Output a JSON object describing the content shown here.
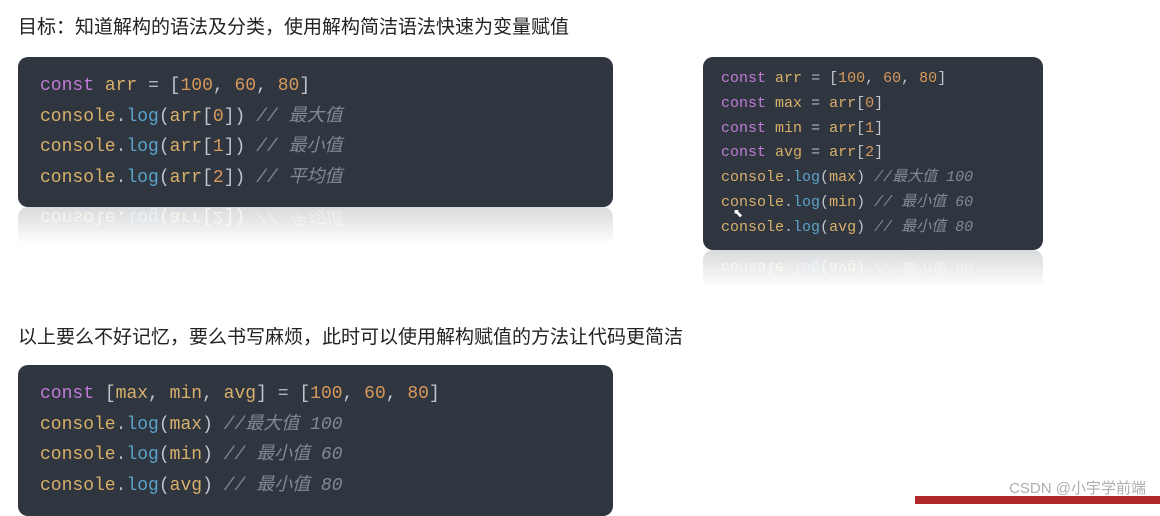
{
  "heading": "目标：知道解构的语法及分类，使用解构简洁语法快速为变量赋值",
  "code1": {
    "lines": [
      {
        "tokens": [
          {
            "c": "kw",
            "t": "const"
          },
          {
            "c": "",
            "t": " "
          },
          {
            "c": "var",
            "t": "arr"
          },
          {
            "c": "",
            "t": " "
          },
          {
            "c": "op",
            "t": "="
          },
          {
            "c": "",
            "t": " "
          },
          {
            "c": "paren",
            "t": "["
          },
          {
            "c": "num",
            "t": "100"
          },
          {
            "c": "paren",
            "t": ", "
          },
          {
            "c": "num",
            "t": "60"
          },
          {
            "c": "paren",
            "t": ", "
          },
          {
            "c": "num",
            "t": "80"
          },
          {
            "c": "paren",
            "t": "]"
          }
        ]
      },
      {
        "tokens": [
          {
            "c": "var",
            "t": "console"
          },
          {
            "c": "op",
            "t": "."
          },
          {
            "c": "fn",
            "t": "log"
          },
          {
            "c": "paren",
            "t": "("
          },
          {
            "c": "var",
            "t": "arr"
          },
          {
            "c": "paren",
            "t": "["
          },
          {
            "c": "num",
            "t": "0"
          },
          {
            "c": "paren",
            "t": "])"
          },
          {
            "c": "",
            "t": " "
          },
          {
            "c": "comment",
            "t": "// 最大值"
          }
        ]
      },
      {
        "tokens": [
          {
            "c": "var",
            "t": "console"
          },
          {
            "c": "op",
            "t": "."
          },
          {
            "c": "fn",
            "t": "log"
          },
          {
            "c": "paren",
            "t": "("
          },
          {
            "c": "var",
            "t": "arr"
          },
          {
            "c": "paren",
            "t": "["
          },
          {
            "c": "num",
            "t": "1"
          },
          {
            "c": "paren",
            "t": "])"
          },
          {
            "c": "",
            "t": " "
          },
          {
            "c": "comment",
            "t": "// 最小值"
          }
        ]
      },
      {
        "tokens": [
          {
            "c": "var",
            "t": "console"
          },
          {
            "c": "op",
            "t": "."
          },
          {
            "c": "fn",
            "t": "log"
          },
          {
            "c": "paren",
            "t": "("
          },
          {
            "c": "var",
            "t": "arr"
          },
          {
            "c": "paren",
            "t": "["
          },
          {
            "c": "num",
            "t": "2"
          },
          {
            "c": "paren",
            "t": "])"
          },
          {
            "c": "",
            "t": " "
          },
          {
            "c": "comment",
            "t": "// 平均值"
          }
        ]
      }
    ]
  },
  "code2": {
    "lines": [
      {
        "tokens": [
          {
            "c": "kw",
            "t": "const"
          },
          {
            "c": "",
            "t": " "
          },
          {
            "c": "var",
            "t": "arr"
          },
          {
            "c": "",
            "t": " "
          },
          {
            "c": "op",
            "t": "="
          },
          {
            "c": "",
            "t": " "
          },
          {
            "c": "paren",
            "t": "["
          },
          {
            "c": "num",
            "t": "100"
          },
          {
            "c": "paren",
            "t": ", "
          },
          {
            "c": "num",
            "t": "60"
          },
          {
            "c": "paren",
            "t": ", "
          },
          {
            "c": "num",
            "t": "80"
          },
          {
            "c": "paren",
            "t": "]"
          }
        ]
      },
      {
        "tokens": [
          {
            "c": "kw",
            "t": "const"
          },
          {
            "c": "",
            "t": " "
          },
          {
            "c": "var",
            "t": "max"
          },
          {
            "c": "",
            "t": " "
          },
          {
            "c": "op",
            "t": "="
          },
          {
            "c": "",
            "t": " "
          },
          {
            "c": "var",
            "t": "arr"
          },
          {
            "c": "paren",
            "t": "["
          },
          {
            "c": "num",
            "t": "0"
          },
          {
            "c": "paren",
            "t": "]"
          }
        ]
      },
      {
        "tokens": [
          {
            "c": "kw",
            "t": "const"
          },
          {
            "c": "",
            "t": " "
          },
          {
            "c": "var",
            "t": "min"
          },
          {
            "c": "",
            "t": " "
          },
          {
            "c": "op",
            "t": "="
          },
          {
            "c": "",
            "t": " "
          },
          {
            "c": "var",
            "t": "arr"
          },
          {
            "c": "paren",
            "t": "["
          },
          {
            "c": "num",
            "t": "1"
          },
          {
            "c": "paren",
            "t": "]"
          }
        ]
      },
      {
        "tokens": [
          {
            "c": "kw",
            "t": "const"
          },
          {
            "c": "",
            "t": " "
          },
          {
            "c": "var",
            "t": "avg"
          },
          {
            "c": "",
            "t": " "
          },
          {
            "c": "op",
            "t": "="
          },
          {
            "c": "",
            "t": " "
          },
          {
            "c": "var",
            "t": "arr"
          },
          {
            "c": "paren",
            "t": "["
          },
          {
            "c": "num",
            "t": "2"
          },
          {
            "c": "paren",
            "t": "]"
          }
        ]
      },
      {
        "tokens": [
          {
            "c": "var",
            "t": "console"
          },
          {
            "c": "op",
            "t": "."
          },
          {
            "c": "fn",
            "t": "log"
          },
          {
            "c": "paren",
            "t": "("
          },
          {
            "c": "var",
            "t": "max"
          },
          {
            "c": "paren",
            "t": ")"
          },
          {
            "c": "",
            "t": " "
          },
          {
            "c": "comment",
            "t": "//最大值 100"
          }
        ]
      },
      {
        "tokens": [
          {
            "c": "var",
            "t": "console"
          },
          {
            "c": "op",
            "t": "."
          },
          {
            "c": "fn",
            "t": "log"
          },
          {
            "c": "paren",
            "t": "("
          },
          {
            "c": "var",
            "t": "min"
          },
          {
            "c": "paren",
            "t": ")"
          },
          {
            "c": "",
            "t": " "
          },
          {
            "c": "comment",
            "t": "// 最小值 60"
          }
        ]
      },
      {
        "tokens": [
          {
            "c": "var",
            "t": "console"
          },
          {
            "c": "op",
            "t": "."
          },
          {
            "c": "fn",
            "t": "log"
          },
          {
            "c": "paren",
            "t": "("
          },
          {
            "c": "var",
            "t": "avg"
          },
          {
            "c": "paren",
            "t": ")"
          },
          {
            "c": "",
            "t": " "
          },
          {
            "c": "comment",
            "t": "// 最小值 80"
          }
        ]
      }
    ]
  },
  "paragraph": "以上要么不好记忆，要么书写麻烦，此时可以使用解构赋值的方法让代码更简洁",
  "code3": {
    "lines": [
      {
        "tokens": [
          {
            "c": "kw",
            "t": "const"
          },
          {
            "c": "",
            "t": " "
          },
          {
            "c": "paren",
            "t": "["
          },
          {
            "c": "var",
            "t": "max"
          },
          {
            "c": "paren",
            "t": ", "
          },
          {
            "c": "var",
            "t": "min"
          },
          {
            "c": "paren",
            "t": ", "
          },
          {
            "c": "var",
            "t": "avg"
          },
          {
            "c": "paren",
            "t": "]"
          },
          {
            "c": "",
            "t": " "
          },
          {
            "c": "op",
            "t": "="
          },
          {
            "c": "",
            "t": " "
          },
          {
            "c": "paren",
            "t": "["
          },
          {
            "c": "num",
            "t": "100"
          },
          {
            "c": "paren",
            "t": ", "
          },
          {
            "c": "num",
            "t": "60"
          },
          {
            "c": "paren",
            "t": ", "
          },
          {
            "c": "num",
            "t": "80"
          },
          {
            "c": "paren",
            "t": "]"
          }
        ]
      },
      {
        "tokens": [
          {
            "c": "var",
            "t": "console"
          },
          {
            "c": "op",
            "t": "."
          },
          {
            "c": "fn",
            "t": "log"
          },
          {
            "c": "paren",
            "t": "("
          },
          {
            "c": "var",
            "t": "max"
          },
          {
            "c": "paren",
            "t": ")"
          },
          {
            "c": "",
            "t": " "
          },
          {
            "c": "comment",
            "t": "//最大值 100"
          }
        ]
      },
      {
        "tokens": [
          {
            "c": "var",
            "t": "console"
          },
          {
            "c": "op",
            "t": "."
          },
          {
            "c": "fn",
            "t": "log"
          },
          {
            "c": "paren",
            "t": "("
          },
          {
            "c": "var",
            "t": "min"
          },
          {
            "c": "paren",
            "t": ")"
          },
          {
            "c": "",
            "t": " "
          },
          {
            "c": "comment",
            "t": "// 最小值 60"
          }
        ]
      },
      {
        "tokens": [
          {
            "c": "var",
            "t": "console"
          },
          {
            "c": "op",
            "t": "."
          },
          {
            "c": "fn",
            "t": "log"
          },
          {
            "c": "paren",
            "t": "("
          },
          {
            "c": "var",
            "t": "avg"
          },
          {
            "c": "paren",
            "t": ")"
          },
          {
            "c": "",
            "t": " "
          },
          {
            "c": "comment",
            "t": "// 最小值 80"
          }
        ]
      }
    ]
  },
  "watermark": "CSDN @小宇学前端"
}
